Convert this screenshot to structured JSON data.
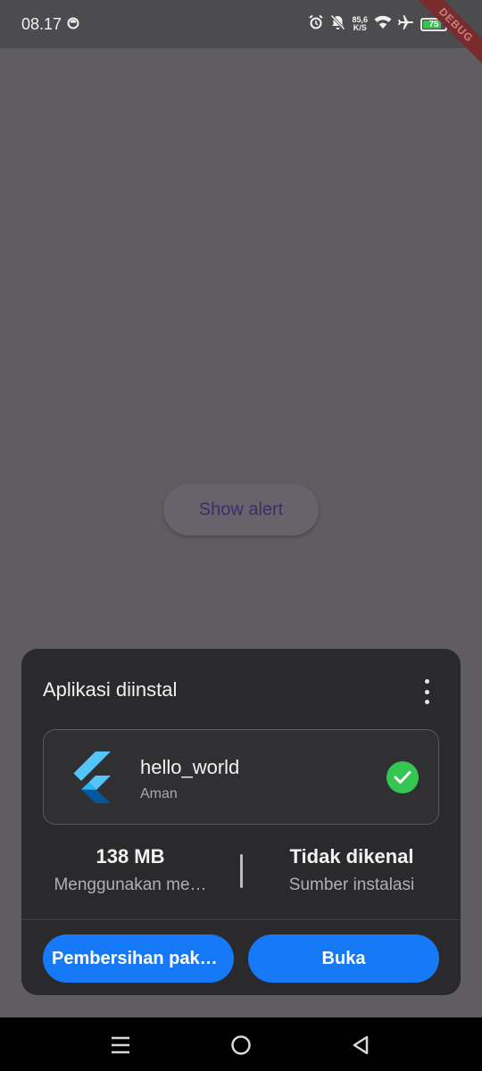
{
  "status_bar": {
    "time": "08.17",
    "network_speed_value": "85,6",
    "network_speed_unit": "K/S",
    "battery_level": "75"
  },
  "debug_banner": "DEBUG",
  "main": {
    "show_alert_label": "Show alert"
  },
  "sheet": {
    "title": "Aplikasi diinstal",
    "app": {
      "name": "hello_world",
      "status": "Aman"
    },
    "stats": {
      "size_value": "138 MB",
      "size_label": "Menggunakan me…",
      "source_value": "Tidak dikenal",
      "source_label": "Sumber instalasi"
    },
    "buttons": {
      "cleanup_label": "Pembersihan paket…",
      "open_label": "Buka"
    }
  },
  "colors": {
    "accent": "#1679f8",
    "success": "#35c552",
    "sheet_bg": "#2a2a2c"
  }
}
